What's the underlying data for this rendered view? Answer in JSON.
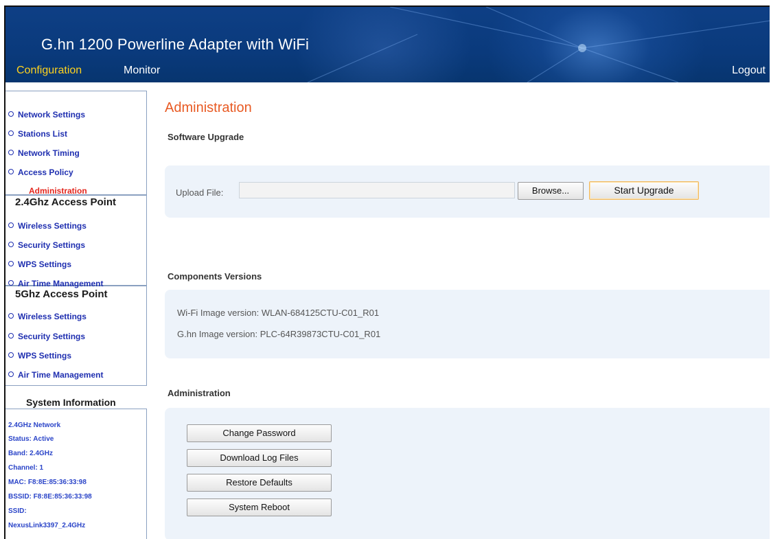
{
  "header": {
    "product_title": "G.hn 1200 Powerline Adapter with WiFi",
    "tabs": [
      {
        "label": "Configuration",
        "active": true
      },
      {
        "label": "Monitor",
        "active": false
      }
    ],
    "logout_label": "Logout",
    "active_tab_color": "#ffd21e",
    "bg_color": "#0b3c80"
  },
  "sidebar": {
    "general_items": [
      {
        "label": "Network Settings"
      },
      {
        "label": "Stations List"
      },
      {
        "label": "Network Timing"
      },
      {
        "label": "Access Policy"
      },
      {
        "label": "Administration",
        "active": true
      }
    ],
    "ap24": {
      "title": "2.4Ghz Access Point",
      "items": [
        {
          "label": "Wireless Settings"
        },
        {
          "label": "Security Settings"
        },
        {
          "label": "WPS Settings"
        },
        {
          "label": "Air Time Management"
        }
      ]
    },
    "ap5": {
      "title": "5Ghz Access Point",
      "items": [
        {
          "label": "Wireless Settings"
        },
        {
          "label": "Security Settings"
        },
        {
          "label": "WPS Settings"
        },
        {
          "label": "Air Time Management"
        }
      ]
    },
    "system_info": {
      "title": "System Information",
      "lines": [
        "2.4GHz Network",
        "Status: Active",
        "Band: 2.4GHz",
        "Channel: 1",
        "MAC: F8:8E:85:36:33:98",
        "BSSID: F8:8E:85:36:33:98",
        "SSID:",
        "NexusLink3397_2.4GHz"
      ]
    },
    "link_color": "#1f2fb0",
    "active_color": "#e2241b"
  },
  "main": {
    "page_title": "Administration",
    "software_upgrade": {
      "section_label": "Software Upgrade",
      "upload_label": "Upload File:",
      "upload_value": "",
      "browse_label": "Browse...",
      "start_upgrade_label": "Start Upgrade"
    },
    "components": {
      "section_label": "Components Versions",
      "wifi_label": "Wi-Fi Image version:",
      "wifi_value": "WLAN-684125CTU-C01_R01",
      "ghn_label": "G.hn Image version:",
      "ghn_value": "PLC-64R39873CTU-C01_R01"
    },
    "administration": {
      "section_label": "Administration",
      "buttons": [
        {
          "label": "Change Password"
        },
        {
          "label": "Download Log Files"
        },
        {
          "label": "Restore Defaults"
        },
        {
          "label": "System Reboot"
        }
      ]
    },
    "title_color": "#e85a23",
    "panel_color": "#edf3fa"
  }
}
